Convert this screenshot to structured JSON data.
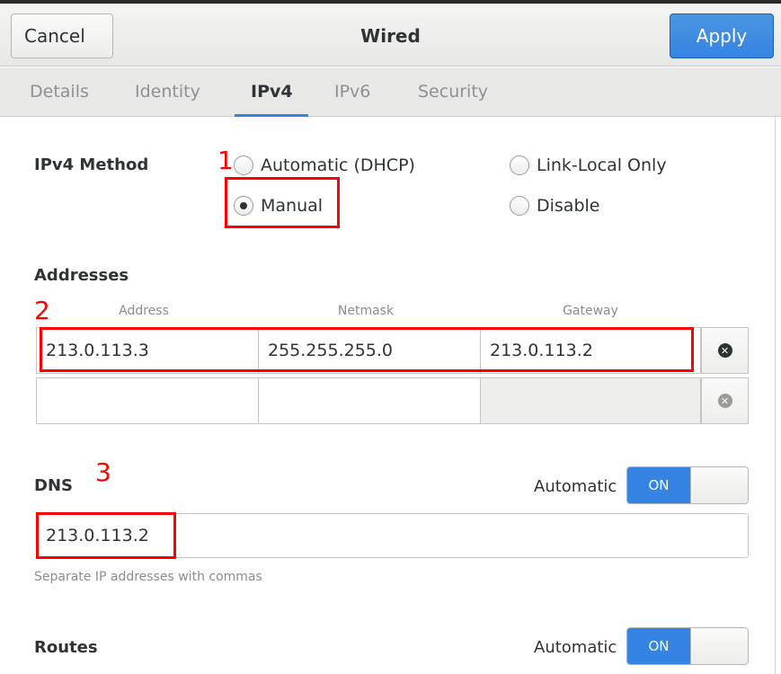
{
  "header": {
    "cancel_label": "Cancel",
    "title": "Wired",
    "apply_label": "Apply"
  },
  "tabs": [
    {
      "label": "Details",
      "active": false
    },
    {
      "label": "Identity",
      "active": false
    },
    {
      "label": "IPv4",
      "active": true
    },
    {
      "label": "IPv6",
      "active": false
    },
    {
      "label": "Security",
      "active": false
    }
  ],
  "ipv4_method": {
    "label": "IPv4 Method",
    "options": {
      "automatic": {
        "label": "Automatic (DHCP)",
        "checked": false
      },
      "link_local": {
        "label": "Link-Local Only",
        "checked": false
      },
      "manual": {
        "label": "Manual",
        "checked": true
      },
      "disable": {
        "label": "Disable",
        "checked": false
      }
    }
  },
  "addresses": {
    "label": "Addresses",
    "columns": [
      "Address",
      "Netmask",
      "Gateway"
    ],
    "rows": [
      {
        "address": "213.0.113.3",
        "netmask": "255.255.255.0",
        "gateway": "213.0.113.2"
      },
      {
        "address": "",
        "netmask": "",
        "gateway": ""
      }
    ]
  },
  "dns": {
    "label": "DNS",
    "automatic_label": "Automatic",
    "switch_label": "ON",
    "value": "213.0.113.2",
    "hint": "Separate IP addresses with commas"
  },
  "routes": {
    "label": "Routes",
    "automatic_label": "Automatic",
    "switch_label": "ON"
  },
  "annotations": [
    "1",
    "2",
    "3"
  ],
  "colors": {
    "accent": "#3584e4",
    "annotation": "#ff0000"
  },
  "icons": {
    "remove": "x-circle-icon"
  }
}
